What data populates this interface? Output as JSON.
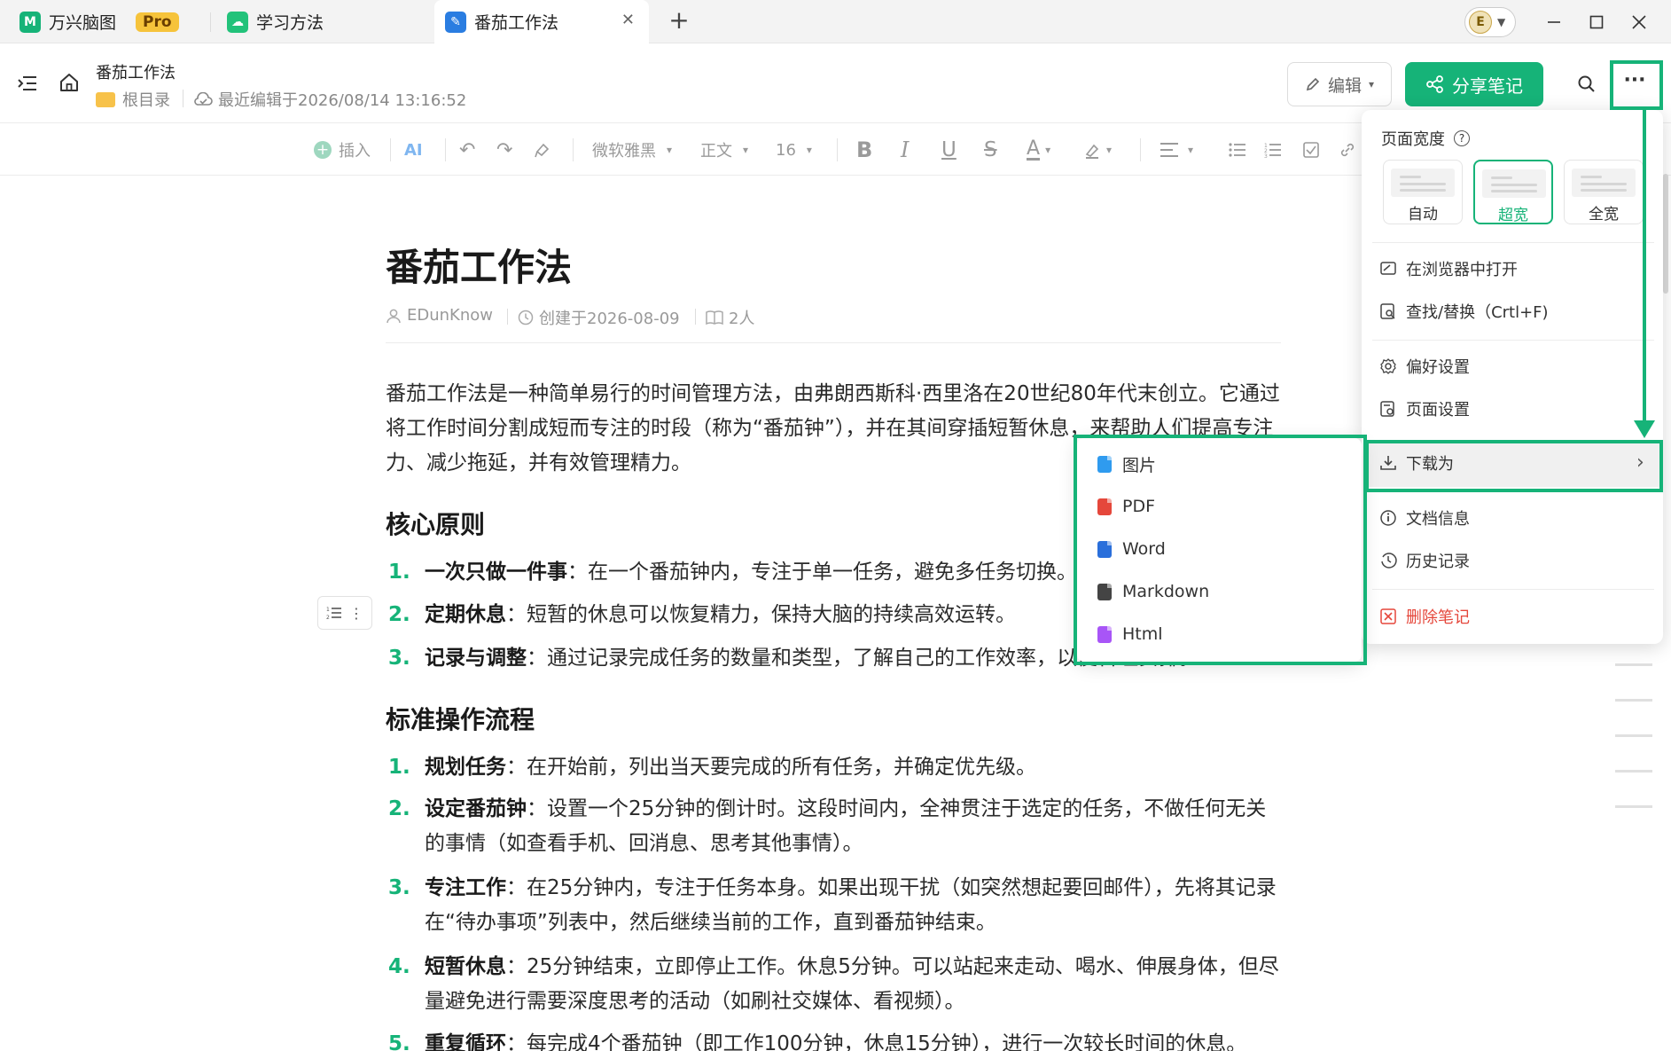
{
  "tabs": [
    {
      "label": "万兴脑图",
      "badge": "Pro",
      "icon": "mindmap-app-icon"
    },
    {
      "label": "学习方法",
      "icon": "cloud-notebook-icon"
    },
    {
      "label": "番茄工作法",
      "icon": "note-doc-icon",
      "active": true
    }
  ],
  "header": {
    "title": "番茄工作法",
    "folder": "根目录",
    "last_edit": "最近编辑于2026/08/14 13:16:52",
    "edit_label": "编辑",
    "share_label": "分享笔记"
  },
  "toolbar": {
    "insert": "插入",
    "font": "微软雅黑",
    "style": "正文",
    "size": "16"
  },
  "doc": {
    "title": "番茄工作法",
    "author": "EDunKnow",
    "created": "创建于2026-08-09",
    "readers": "2人",
    "intro": "番茄工作法是一种简单易行的时间管理方法，由弗朗西斯科·西里洛在20世纪80年代末创立。它通过将工作时间分割成短而专注的时段（称为“番茄钟”），并在其间穿插短暂休息，来帮助人们提高专注力、减少拖延，并有效管理精力。",
    "h_core": "核心原则",
    "core": [
      {
        "n": "1.",
        "b": "一次只做一件事",
        "t": "：在一个番茄钟内，专注于单一任务，避免多任务切换。"
      },
      {
        "n": "2.",
        "b": "定期休息",
        "t": "：短暂的休息可以恢复精力，保持大脑的持续高效运转。"
      },
      {
        "n": "3.",
        "b": "记录与调整",
        "t": "：通过记录完成任务的数量和类型，了解自己的工作效率，以便合理安排。"
      }
    ],
    "h_flow": "标准操作流程",
    "flow": [
      {
        "n": "1.",
        "b": "规划任务",
        "t": "：在开始前，列出当天要完成的所有任务，并确定优先级。"
      },
      {
        "n": "2.",
        "b": "设定番茄钟",
        "t": "：设置一个25分钟的倒计时。这段时间内，全神贯注于选定的任务，不做任何无关的事情（如查看手机、回消息、思考其他事情）。"
      },
      {
        "n": "3.",
        "b": "专注工作",
        "t": "：在25分钟内，专注于任务本身。如果出现干扰（如突然想起要回邮件），先将其记录在“待办事项”列表中，然后继续当前的工作，直到番茄钟结束。"
      },
      {
        "n": "4.",
        "b": "短暂休息",
        "t": "：25分钟结束，立即停止工作。休息5分钟。可以站起来走动、喝水、伸展身体，但尽量避免进行需要深度思考的活动（如刷社交媒体、看视频）。"
      },
      {
        "n": "5.",
        "b": "重复循环",
        "t": "：每完成4个番茄钟（即工作100分钟，休息15分钟），进行一次较长时间的休息。"
      }
    ]
  },
  "menu": {
    "width_label": "页面宽度",
    "width_options": [
      "自动",
      "超宽",
      "全宽"
    ],
    "width_selected": "超宽",
    "open_browser": "在浏览器中打开",
    "find_replace": "查找/替换（Crtl+F)",
    "preferences": "偏好设置",
    "page_settings": "页面设置",
    "download_as": "下载为",
    "doc_info": "文档信息",
    "history": "历史记录",
    "delete": "删除笔记"
  },
  "download_submenu": [
    {
      "label": "图片",
      "color": "#2f9bef"
    },
    {
      "label": "PDF",
      "color": "#e5473b"
    },
    {
      "label": "Word",
      "color": "#2a6fdb"
    },
    {
      "label": "Markdown",
      "color": "#444444"
    },
    {
      "label": "Html",
      "color": "#a855f7"
    }
  ],
  "colors": {
    "accent": "#16b378",
    "danger": "#e5473b"
  }
}
